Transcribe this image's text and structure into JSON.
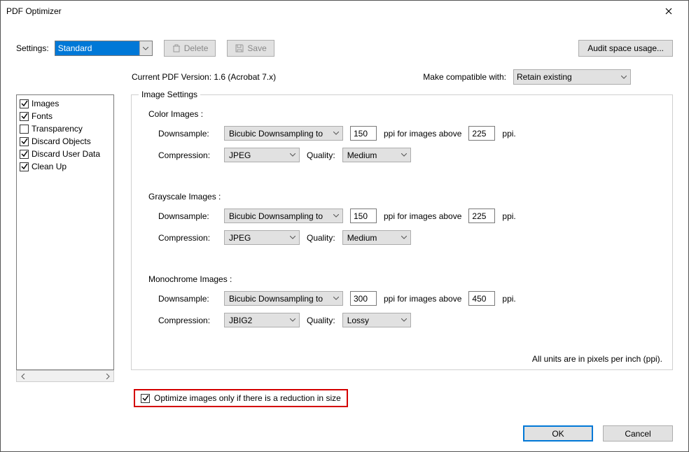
{
  "dialog": {
    "title": "PDF Optimizer"
  },
  "toolbar": {
    "settings_label": "Settings:",
    "settings_value": "Standard",
    "delete_label": "Delete",
    "save_label": "Save",
    "audit_label": "Audit space usage..."
  },
  "versionrow": {
    "current_label": "Current PDF Version: 1.6 (Acrobat 7.x)",
    "compat_label": "Make compatible with:",
    "compat_value": "Retain existing"
  },
  "sidebar": {
    "items": [
      {
        "label": "Images",
        "checked": true
      },
      {
        "label": "Fonts",
        "checked": true
      },
      {
        "label": "Transparency",
        "checked": false
      },
      {
        "label": "Discard Objects",
        "checked": true
      },
      {
        "label": "Discard User Data",
        "checked": true
      },
      {
        "label": "Clean Up",
        "checked": true
      }
    ]
  },
  "panel": {
    "title": "Image Settings",
    "color": {
      "heading": "Color Images :",
      "downsample_label": "Downsample:",
      "downsample_value": "Bicubic Downsampling to",
      "ppi": "150",
      "above_label": "ppi for images above",
      "above_ppi": "225",
      "ppi_unit": "ppi.",
      "compression_label": "Compression:",
      "compression_value": "JPEG",
      "quality_label": "Quality:",
      "quality_value": "Medium"
    },
    "gray": {
      "heading": "Grayscale Images :",
      "downsample_label": "Downsample:",
      "downsample_value": "Bicubic Downsampling to",
      "ppi": "150",
      "above_label": "ppi for images above",
      "above_ppi": "225",
      "ppi_unit": "ppi.",
      "compression_label": "Compression:",
      "compression_value": "JPEG",
      "quality_label": "Quality:",
      "quality_value": "Medium"
    },
    "mono": {
      "heading": "Monochrome Images :",
      "downsample_label": "Downsample:",
      "downsample_value": "Bicubic Downsampling to",
      "ppi": "300",
      "above_label": "ppi for images above",
      "above_ppi": "450",
      "ppi_unit": "ppi.",
      "compression_label": "Compression:",
      "compression_value": "JBIG2",
      "quality_label": "Quality:",
      "quality_value": "Lossy"
    },
    "units_note": "All units are in pixels per inch (ppi)."
  },
  "optimize_row": {
    "label": "Optimize images only if there is a reduction in size"
  },
  "buttons": {
    "ok": "OK",
    "cancel": "Cancel"
  }
}
